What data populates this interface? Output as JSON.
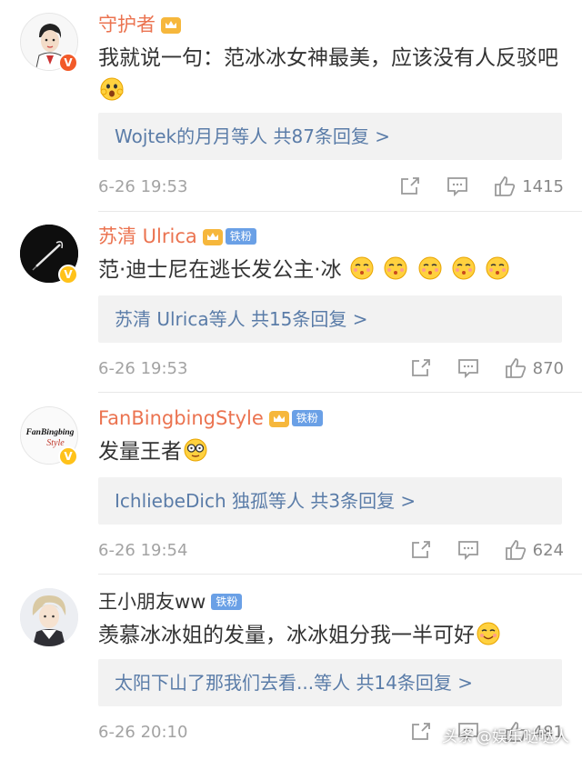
{
  "comments": [
    {
      "username": "守护者",
      "text": "我就说一句：范冰冰女神最美，应该没有人反驳吧",
      "replies_names": "Wojtek的月月等人",
      "replies_count": "共87条回复 >",
      "time": "6-26 19:53",
      "likes": "1415",
      "verified": "V",
      "avatar": "cartoon-boy"
    },
    {
      "username": "苏清 Ulrica",
      "fan_badge": "铁粉",
      "text": "范·迪士尼在逃长发公主·冰",
      "replies_names": "苏清 Ulrica等人",
      "replies_count": "共15条回复 >",
      "time": "6-26 19:53",
      "likes": "870",
      "verified": "V",
      "avatar": "dark-pen"
    },
    {
      "username": "FanBingbingStyle",
      "fan_badge": "铁粉",
      "text": "发量王者",
      "replies_names": "IchliebeDich 独孤等人",
      "replies_count": "共3条回复 >",
      "time": "6-26 19:54",
      "likes": "624",
      "verified": "V",
      "avatar_text_1": "FanBingbing",
      "avatar_text_2": "Style"
    },
    {
      "username": "王小朋友ww",
      "fan_badge": "铁粉",
      "text": "羡慕冰冰姐的发量，冰冰姐分我一半可好",
      "replies_names": "太阳下山了那我们去看...等人",
      "replies_count": "共14条回复 >",
      "time": "6-26 20:10",
      "likes": "481",
      "avatar": "anime-boy"
    }
  ],
  "watermark": {
    "logo": "头条",
    "account": "@娱乐哒哒人"
  },
  "colors": {
    "username_orange": "#eb7350",
    "link_blue": "#5a7ca8",
    "reply_bg": "#f2f2f2",
    "fan_badge": "#6aa0e6"
  },
  "icons": [
    "repost-icon",
    "comment-icon",
    "like-icon",
    "crown-icon",
    "verified-v-icon"
  ]
}
